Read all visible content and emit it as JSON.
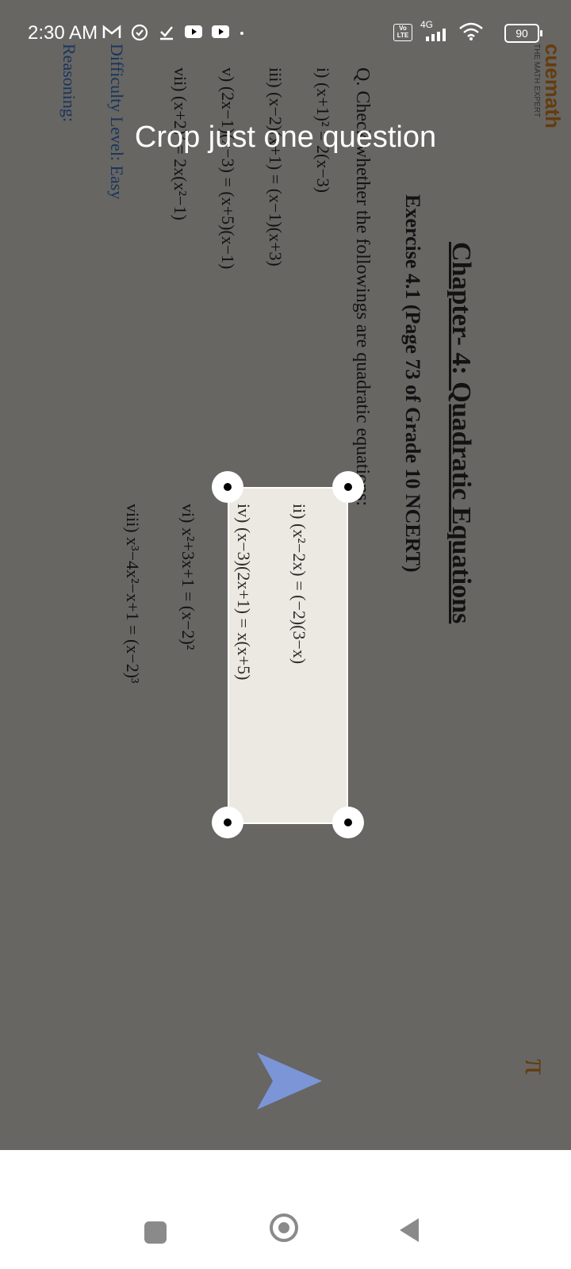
{
  "status_bar": {
    "time": "2:30 AM",
    "network": "4G",
    "volte": "Vo LTE",
    "battery": "90"
  },
  "instruction": "Crop just one question",
  "document": {
    "brand": "cuemath",
    "brand_tagline": "THE MATH EXPERT",
    "chapter_title": "Chapter- 4: Quadratic Equations",
    "exercise": "Exercise 4.1 (Page 73 of Grade 10 NCERT)",
    "question": "Q. Check whether the followings are quadratic equations:",
    "items": [
      "i) (x+1)² = 2(x−3)",
      "ii) (x²−2x) = (−2)(3−x)",
      "iii) (x−2)(x+1) = (x−1)(x+3)",
      "iv) (x−3)(2x+1) = x(x+5)",
      "v) (2x−1)(x−3) = (x+5)(x−1)",
      "vi) x²+3x+1 = (x−2)²",
      "vii) (x+2)³ = 2x(x²−1)",
      "viii) x³−4x²−x+1 = (x−2)³"
    ],
    "difficulty": "Difficulty Level: Easy",
    "reasoning": "Reasoning:",
    "corner_symbol": "π"
  },
  "colors": {
    "send_arrow": "#7b95d6",
    "overlay": "#000000",
    "handle": "#ffffff"
  },
  "icons": [
    "gmail-icon",
    "alarm-icon",
    "download-icon",
    "youtube-icon",
    "wifi-icon",
    "signal-icon",
    "battery-icon",
    "send-icon",
    "recents-icon",
    "home-icon",
    "back-icon"
  ]
}
